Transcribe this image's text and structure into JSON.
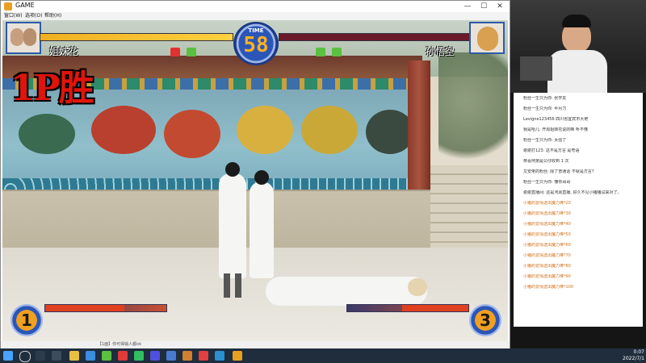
{
  "window": {
    "title": "GAME",
    "menu": [
      "窗口(W)",
      "选项(O)",
      "帮助(H)"
    ],
    "controls": {
      "minimize": "—",
      "maximize": "☐",
      "close": "✕"
    }
  },
  "game": {
    "timer_label": "TIME",
    "timer_value": "58",
    "p1_name": "姐妹花",
    "p2_name": "孙悟空",
    "p1_health": 1.0,
    "p2_health": 0.0,
    "win_text": "1P胜",
    "p1_rounds": "1",
    "p2_rounds": "3",
    "p1_power": 0.65,
    "p2_power": 0.55
  },
  "statusbar": {
    "left": "【1面】你可得输人都ok"
  },
  "chat": {
    "lines": [
      "粉丝一生只为你: 张学友",
      "粉丝一生只为你: 半月刀",
      "Levigne123456 四川省宜宾市大佬",
      "我是哈儿: 开局姐妹花说的嘛 听不懂",
      "粉丝一生只为你: 太强了",
      "谢谢打123: 这不是方言 是粤语",
      "恭喜阿弟是公仔收到 1 次",
      "又安佬的粉丝: 除了普通话 不就是方言?",
      "粉丝一生只为你: 懂你哥哥",
      "谢谢直播间: 这是河源直播, 好久不见小猪猪试来对了。",
      "小猪的爱情送出魔力棒*20",
      "小猪的爱情送出魔力棒*30",
      "小猪的爱情送出魔力棒*40",
      "小猪的爱情送出魔力棒*50",
      "小猪的爱情送出魔力棒*60",
      "小猪的爱情送出魔力棒*70",
      "小猪的爱情送出魔力棒*80",
      "小猪的爱情送出魔力棒*90",
      "小猪的爱情送出魔力棒*100"
    ]
  },
  "clock": {
    "time": "0:07",
    "date": "2022/7/1"
  },
  "colors": {
    "win_red": "#e0140c",
    "timer_digits": "#ffb020",
    "hud_blue": "#2a56b8"
  }
}
